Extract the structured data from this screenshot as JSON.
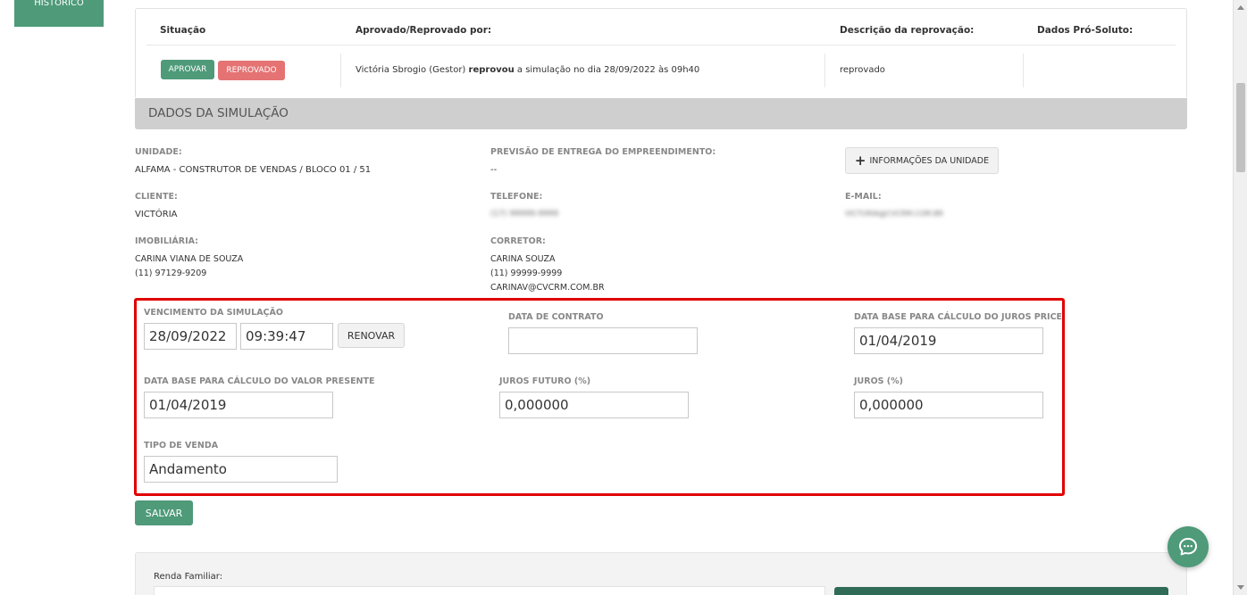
{
  "left_panel": {
    "label": "HISTÓRICO"
  },
  "approval_table": {
    "headers": {
      "situacao": "Situação",
      "aprovado_por": "Aprovado/Reprovado por:",
      "descricao": "Descrição da reprovação:",
      "pro_soluto": "Dados Pró-Soluto:"
    },
    "approve_label": "APROVAR",
    "reject_label": "REPROVADO",
    "row": {
      "who": "Victória Sbrogio (Gestor)",
      "action": "reprovou",
      "rest": "a simulação no dia 28/09/2022 às 09h40",
      "descricao": "reprovado",
      "pro_soluto": ""
    }
  },
  "section": {
    "title": "DADOS DA SIMULAÇÃO"
  },
  "details": {
    "unidade_label": "UNIDADE:",
    "unidade_value": "ALFAMA - CONSTRUTOR DE VENDAS / BLOCO 01 / 51",
    "previsao_label": "PREVISÃO DE ENTREGA DO EMPREENDIMENTO:",
    "previsao_value": "--",
    "info_button": "INFORMAÇÕES DA UNIDADE",
    "cliente_label": "CLIENTE:",
    "cliente_value": "VICTÓRIA",
    "telefone_label": "TELEFONE:",
    "telefone_value": "(17) 99999-9999",
    "email_label": "E-MAIL:",
    "email_value": "VICTORIA@CVCRM.COM.BR",
    "imobiliaria_label": "IMOBILIÁRIA:",
    "imobiliaria_name": "CARINA VIANA DE SOUZA",
    "imobiliaria_phone": "(11) 97129-9209",
    "corretor_label": "CORRETOR:",
    "corretor_name": "CARINA SOUZA",
    "corretor_phone": "(11) 99999-9999",
    "corretor_email": "CARINAV@CVCRM.COM.BR"
  },
  "form": {
    "vencimento_label": "VENCIMENTO DA SIMULAÇÃO",
    "vencimento_date": "28/09/2022",
    "vencimento_time": "09:39:47",
    "renovar_label": "RENOVAR",
    "data_contrato_label": "DATA DE CONTRATO",
    "data_contrato_value": "",
    "juros_price_label": "DATA BASE PARA CÁLCULO DO JUROS PRICE",
    "juros_price_value": "01/04/2019",
    "valor_presente_label": "DATA BASE PARA CÁLCULO DO VALOR PRESENTE",
    "valor_presente_value": "01/04/2019",
    "juros_futuro_label": "JUROS FUTURO (%)",
    "juros_futuro_value": "0,000000",
    "juros_label": "JUROS (%)",
    "juros_value": "0,000000",
    "tipo_venda_label": "TIPO DE VENDA",
    "tipo_venda_value": "Andamento",
    "salvar_label": "SALVAR"
  },
  "bottom": {
    "renda_label": "Renda Familiar:"
  },
  "colors": {
    "accent_green": "#4e9a79",
    "reject_red": "#e57373",
    "highlight_red": "#e00000",
    "section_gray": "#cfcfcf"
  }
}
